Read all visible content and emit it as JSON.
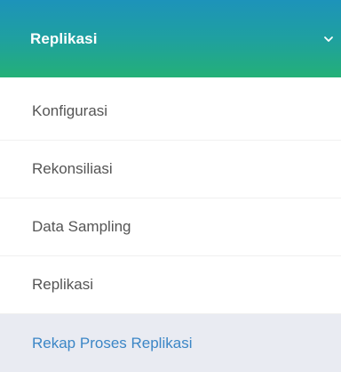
{
  "menu": {
    "header_label": "Replikasi",
    "items": [
      {
        "label": "Konfigurasi",
        "active": false
      },
      {
        "label": "Rekonsiliasi",
        "active": false
      },
      {
        "label": "Data Sampling",
        "active": false
      },
      {
        "label": "Replikasi",
        "active": false
      },
      {
        "label": "Rekap Proses Replikasi",
        "active": true
      }
    ]
  },
  "icons": {
    "header_chevron": "chevron-down-icon"
  },
  "colors": {
    "header_gradient_top": "#1d93ba",
    "header_gradient_bottom": "#24b077",
    "active_item_bg": "#e9ebf2",
    "active_item_text": "#3b86c6",
    "item_text": "#555555"
  }
}
